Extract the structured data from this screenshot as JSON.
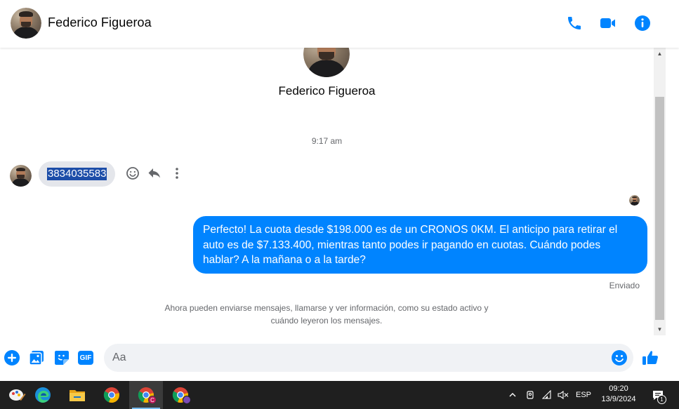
{
  "header": {
    "contact_name": "Federico Figueroa"
  },
  "profile": {
    "name": "Federico Figueroa"
  },
  "conversation": {
    "timestamp": "9:17 am",
    "incoming_message": "3834035583",
    "outgoing_message": "Perfecto! La cuota desde $198.000 es de un CRONOS 0KM. El anticipo para retirar el auto es de $7.133.400, mientras tanto podes ir pagando en cuotas. Cuándo podes hablar? A la mañana o a la tarde?",
    "sent_status": "Enviado",
    "info_note": "Ahora pueden enviarse mensajes, llamarse y ver información, como su estado activo y cuándo leyeron los mensajes."
  },
  "composer": {
    "placeholder": "Aa",
    "gif_label": "GIF"
  },
  "taskbar": {
    "language": "ESP",
    "time": "09:20",
    "date": "13/9/2024",
    "notification_count": "1",
    "chrome_profile_badge": "C"
  },
  "colors": {
    "messenger_blue": "#0084ff",
    "bubble_gray": "#e4e6eb",
    "selection": "#1c4da8"
  },
  "icons": [
    "phone-icon",
    "video-icon",
    "info-icon",
    "emoji-icon",
    "reply-icon",
    "more-icon",
    "plus-icon",
    "image-icon",
    "sticker-icon",
    "gif-icon",
    "like-icon"
  ]
}
